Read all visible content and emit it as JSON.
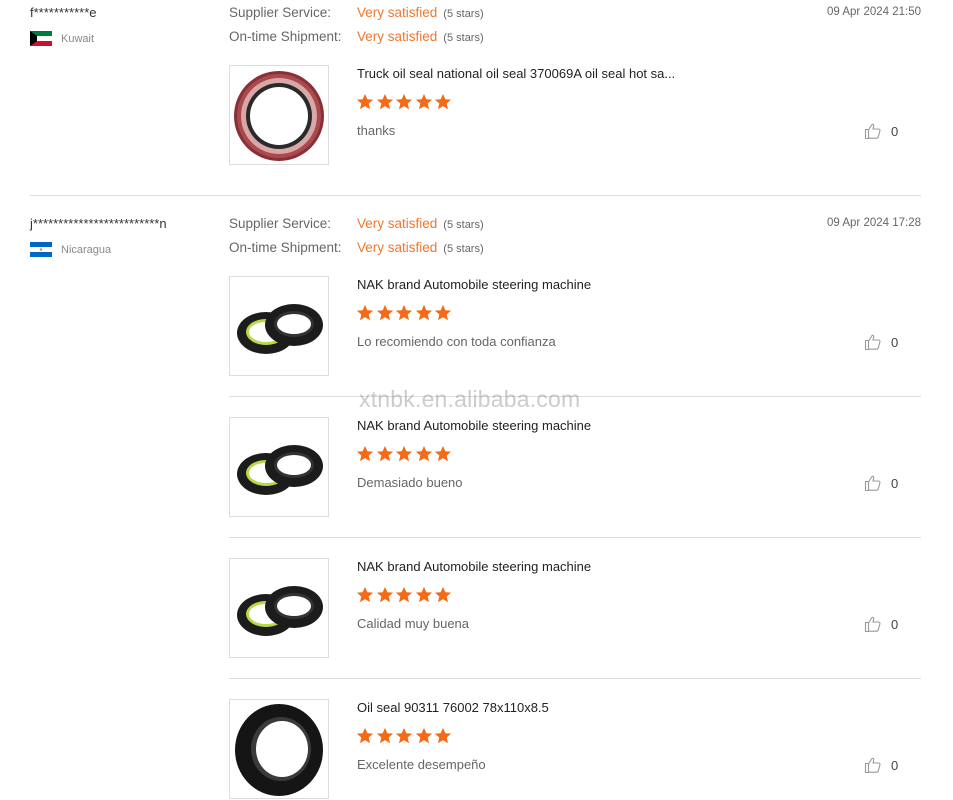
{
  "reviews": [
    {
      "user": "f***********e",
      "country": "Kuwait",
      "date": "09 Apr 2024 21:50",
      "supplier_service": {
        "label": "Supplier Service:",
        "value": "Very satisfied",
        "stars_text": "(5 stars)",
        "rating": 5
      },
      "shipment": {
        "label": "On-time Shipment:",
        "value": "Very satisfied",
        "stars_text": "(5 stars)",
        "rating": 5
      },
      "products": [
        {
          "title": "Truck oil seal national oil seal 370069A oil seal hot sa...",
          "rating": 5,
          "comment": "thanks",
          "likes": "0",
          "image": "red-oil-seal"
        }
      ]
    },
    {
      "user": "j*************************n",
      "country": "Nicaragua",
      "date": "09 Apr 2024 17:28",
      "supplier_service": {
        "label": "Supplier Service:",
        "value": "Very satisfied",
        "stars_text": "(5 stars)",
        "rating": 5
      },
      "shipment": {
        "label": "On-time Shipment:",
        "value": "Very satisfied",
        "stars_text": "(5 stars)",
        "rating": 5
      },
      "products": [
        {
          "title": "NAK brand Automobile steering machine",
          "rating": 5,
          "comment": "Lo recomiendo con toda confianza",
          "likes": "0",
          "image": "double-seal"
        },
        {
          "title": "NAK brand Automobile steering machine",
          "rating": 5,
          "comment": "Demasiado bueno",
          "likes": "0",
          "image": "double-seal"
        },
        {
          "title": "NAK brand Automobile steering machine",
          "rating": 5,
          "comment": "Calidad muy buena",
          "likes": "0",
          "image": "double-seal"
        },
        {
          "title": "Oil seal 90311 76002 78x110x8.5",
          "rating": 5,
          "comment": "Excelente desempeño",
          "likes": "0",
          "image": "black-oil-seal"
        }
      ]
    }
  ],
  "watermark": "xtnbk.en.alibaba.com",
  "colors": {
    "accent": "#f2762e",
    "star": "#f56a16"
  }
}
